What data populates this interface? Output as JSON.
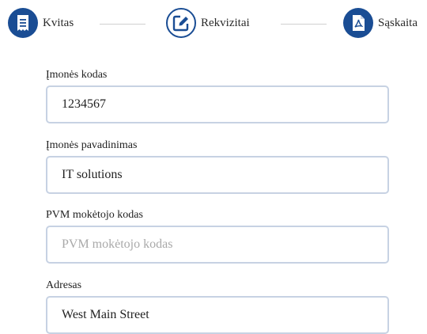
{
  "steps": [
    {
      "label": "Kvitas",
      "icon": "receipt-icon",
      "state": "done"
    },
    {
      "label": "Rekvizitai",
      "icon": "edit-icon",
      "state": "active"
    },
    {
      "label": "Sąskaita",
      "icon": "pdf-file-icon",
      "state": "todo"
    }
  ],
  "form": {
    "company_code": {
      "label": "Įmonės kodas",
      "value": "1234567",
      "placeholder": ""
    },
    "company_name": {
      "label": "Įmonės pavadinimas",
      "value": "IT solutions",
      "placeholder": ""
    },
    "vat_code": {
      "label": "PVM mokėtojo kodas",
      "value": "",
      "placeholder": "PVM mokėtojo kodas"
    },
    "address": {
      "label": "Adresas",
      "value": "West Main Street",
      "placeholder": ""
    }
  },
  "colors": {
    "accent": "#1a4d94",
    "input_border": "#c7d2e3",
    "divider": "#d0d0d0"
  }
}
